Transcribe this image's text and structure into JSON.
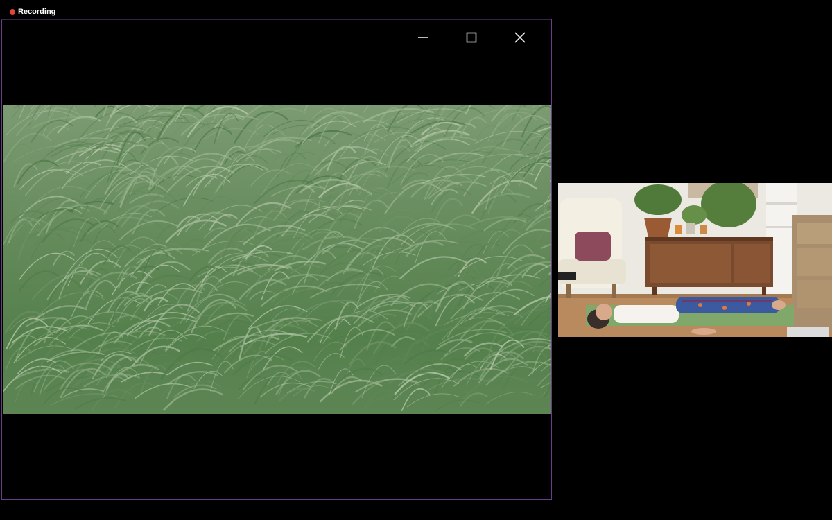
{
  "recording": {
    "label": "Recording",
    "color": "#e0443a"
  },
  "share_window": {
    "border_color": "#6b3d88",
    "controls": {
      "minimize_icon": "minimize-icon",
      "maximize_icon": "maximize-icon",
      "close_icon": "close-icon"
    }
  },
  "shared_content": {
    "scene": "tall-grass-blowing-in-wind",
    "colors": [
      "#6f9265",
      "#4f7a48",
      "#9bb48f"
    ]
  },
  "participant": {
    "scene": "woman-lying-on-yoga-mat",
    "mat_color": "#7fa86a"
  }
}
